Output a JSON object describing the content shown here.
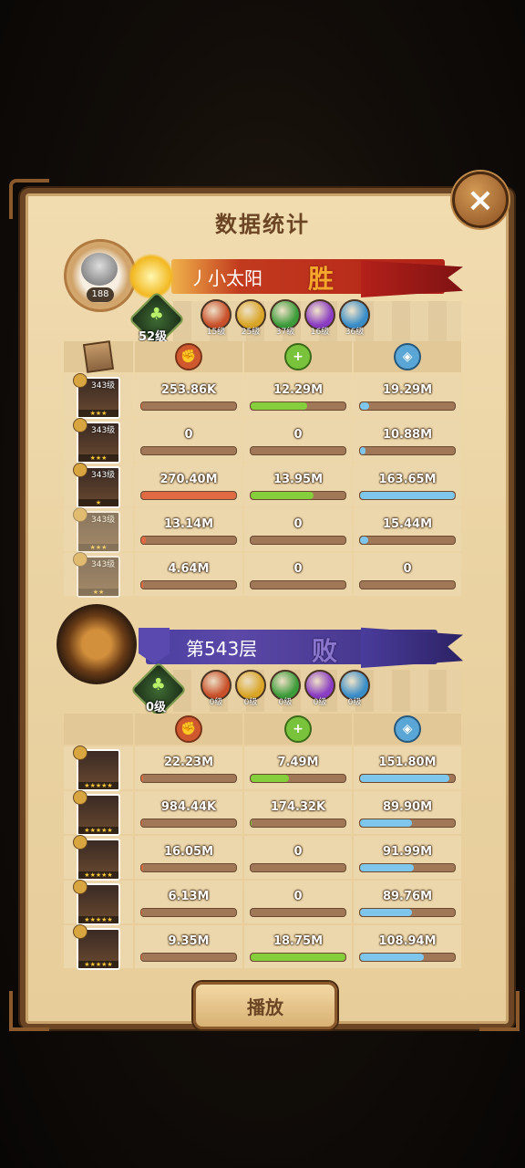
{
  "title": "数据统计",
  "close_icon": "×",
  "play_label": "播放",
  "colors": {
    "win": "#f6a62c",
    "lose": "#8a76cc",
    "damage": "#e06a44",
    "heal": "#86cf3c",
    "defense": "#7ec6ec"
  },
  "player": {
    "avatar_level": "188",
    "name": "丿小太阳",
    "result": "胜",
    "tree_level": "52级",
    "elements": [
      {
        "icon": "fire-element-icon",
        "level": "15级",
        "color": "#c8502a"
      },
      {
        "icon": "holy-element-icon",
        "level": "25级",
        "color": "#d9a526"
      },
      {
        "icon": "nature-element-icon",
        "level": "37级",
        "color": "#3c9c3a"
      },
      {
        "icon": "arcane-element-icon",
        "level": "16级",
        "color": "#8a3cc2"
      },
      {
        "icon": "water-element-icon",
        "level": "36级",
        "color": "#3a8ec8"
      }
    ],
    "heroes": [
      {
        "level": "343级",
        "stars": "★★★",
        "faded": false,
        "damage": "253.86K",
        "heal": "12.29M",
        "defense": "19.29M",
        "damage_pct": 1,
        "heal_pct": 60,
        "defense_pct": 10
      },
      {
        "level": "343级",
        "stars": "★★★",
        "faded": false,
        "damage": "0",
        "heal": "0",
        "defense": "10.88M",
        "damage_pct": 0,
        "heal_pct": 0,
        "defense_pct": 6
      },
      {
        "level": "343级",
        "stars": "★",
        "faded": false,
        "damage": "270.40M",
        "heal": "13.95M",
        "defense": "163.65M",
        "damage_pct": 100,
        "heal_pct": 66,
        "defense_pct": 100
      },
      {
        "level": "343级",
        "stars": "★★★",
        "faded": true,
        "damage": "13.14M",
        "heal": "0",
        "defense": "15.44M",
        "damage_pct": 5,
        "heal_pct": 0,
        "defense_pct": 9
      },
      {
        "level": "343级",
        "stars": "★★",
        "faded": true,
        "damage": "4.64M",
        "heal": "0",
        "defense": "0",
        "damage_pct": 2,
        "heal_pct": 0,
        "defense_pct": 0
      }
    ]
  },
  "enemy": {
    "name": "第543层",
    "result": "败",
    "tree_level": "0级",
    "elements": [
      {
        "icon": "fire-element-icon",
        "level": "0级",
        "color": "#c8502a"
      },
      {
        "icon": "holy-element-icon",
        "level": "0级",
        "color": "#d9a526"
      },
      {
        "icon": "nature-element-icon",
        "level": "0级",
        "color": "#3c9c3a"
      },
      {
        "icon": "arcane-element-icon",
        "level": "0级",
        "color": "#8a3cc2"
      },
      {
        "icon": "water-element-icon",
        "level": "0级",
        "color": "#3a8ec8"
      }
    ],
    "heroes": [
      {
        "stars": "★★★★★",
        "damage": "22.23M",
        "heal": "7.49M",
        "defense": "151.80M",
        "damage_pct": 2,
        "heal_pct": 40,
        "defense_pct": 94
      },
      {
        "stars": "★★★★★",
        "damage": "984.44K",
        "heal": "174.32K",
        "defense": "89.90M",
        "damage_pct": 1,
        "heal_pct": 1,
        "defense_pct": 55
      },
      {
        "stars": "★★★★★",
        "damage": "16.05M",
        "heal": "0",
        "defense": "91.99M",
        "damage_pct": 2,
        "heal_pct": 0,
        "defense_pct": 57
      },
      {
        "stars": "★★★★★",
        "damage": "6.13M",
        "heal": "0",
        "defense": "89.76M",
        "damage_pct": 1,
        "heal_pct": 0,
        "defense_pct": 55
      },
      {
        "stars": "★★★★★",
        "damage": "9.35M",
        "heal": "18.75M",
        "defense": "108.94M",
        "damage_pct": 1,
        "heal_pct": 100,
        "defense_pct": 67
      }
    ]
  }
}
